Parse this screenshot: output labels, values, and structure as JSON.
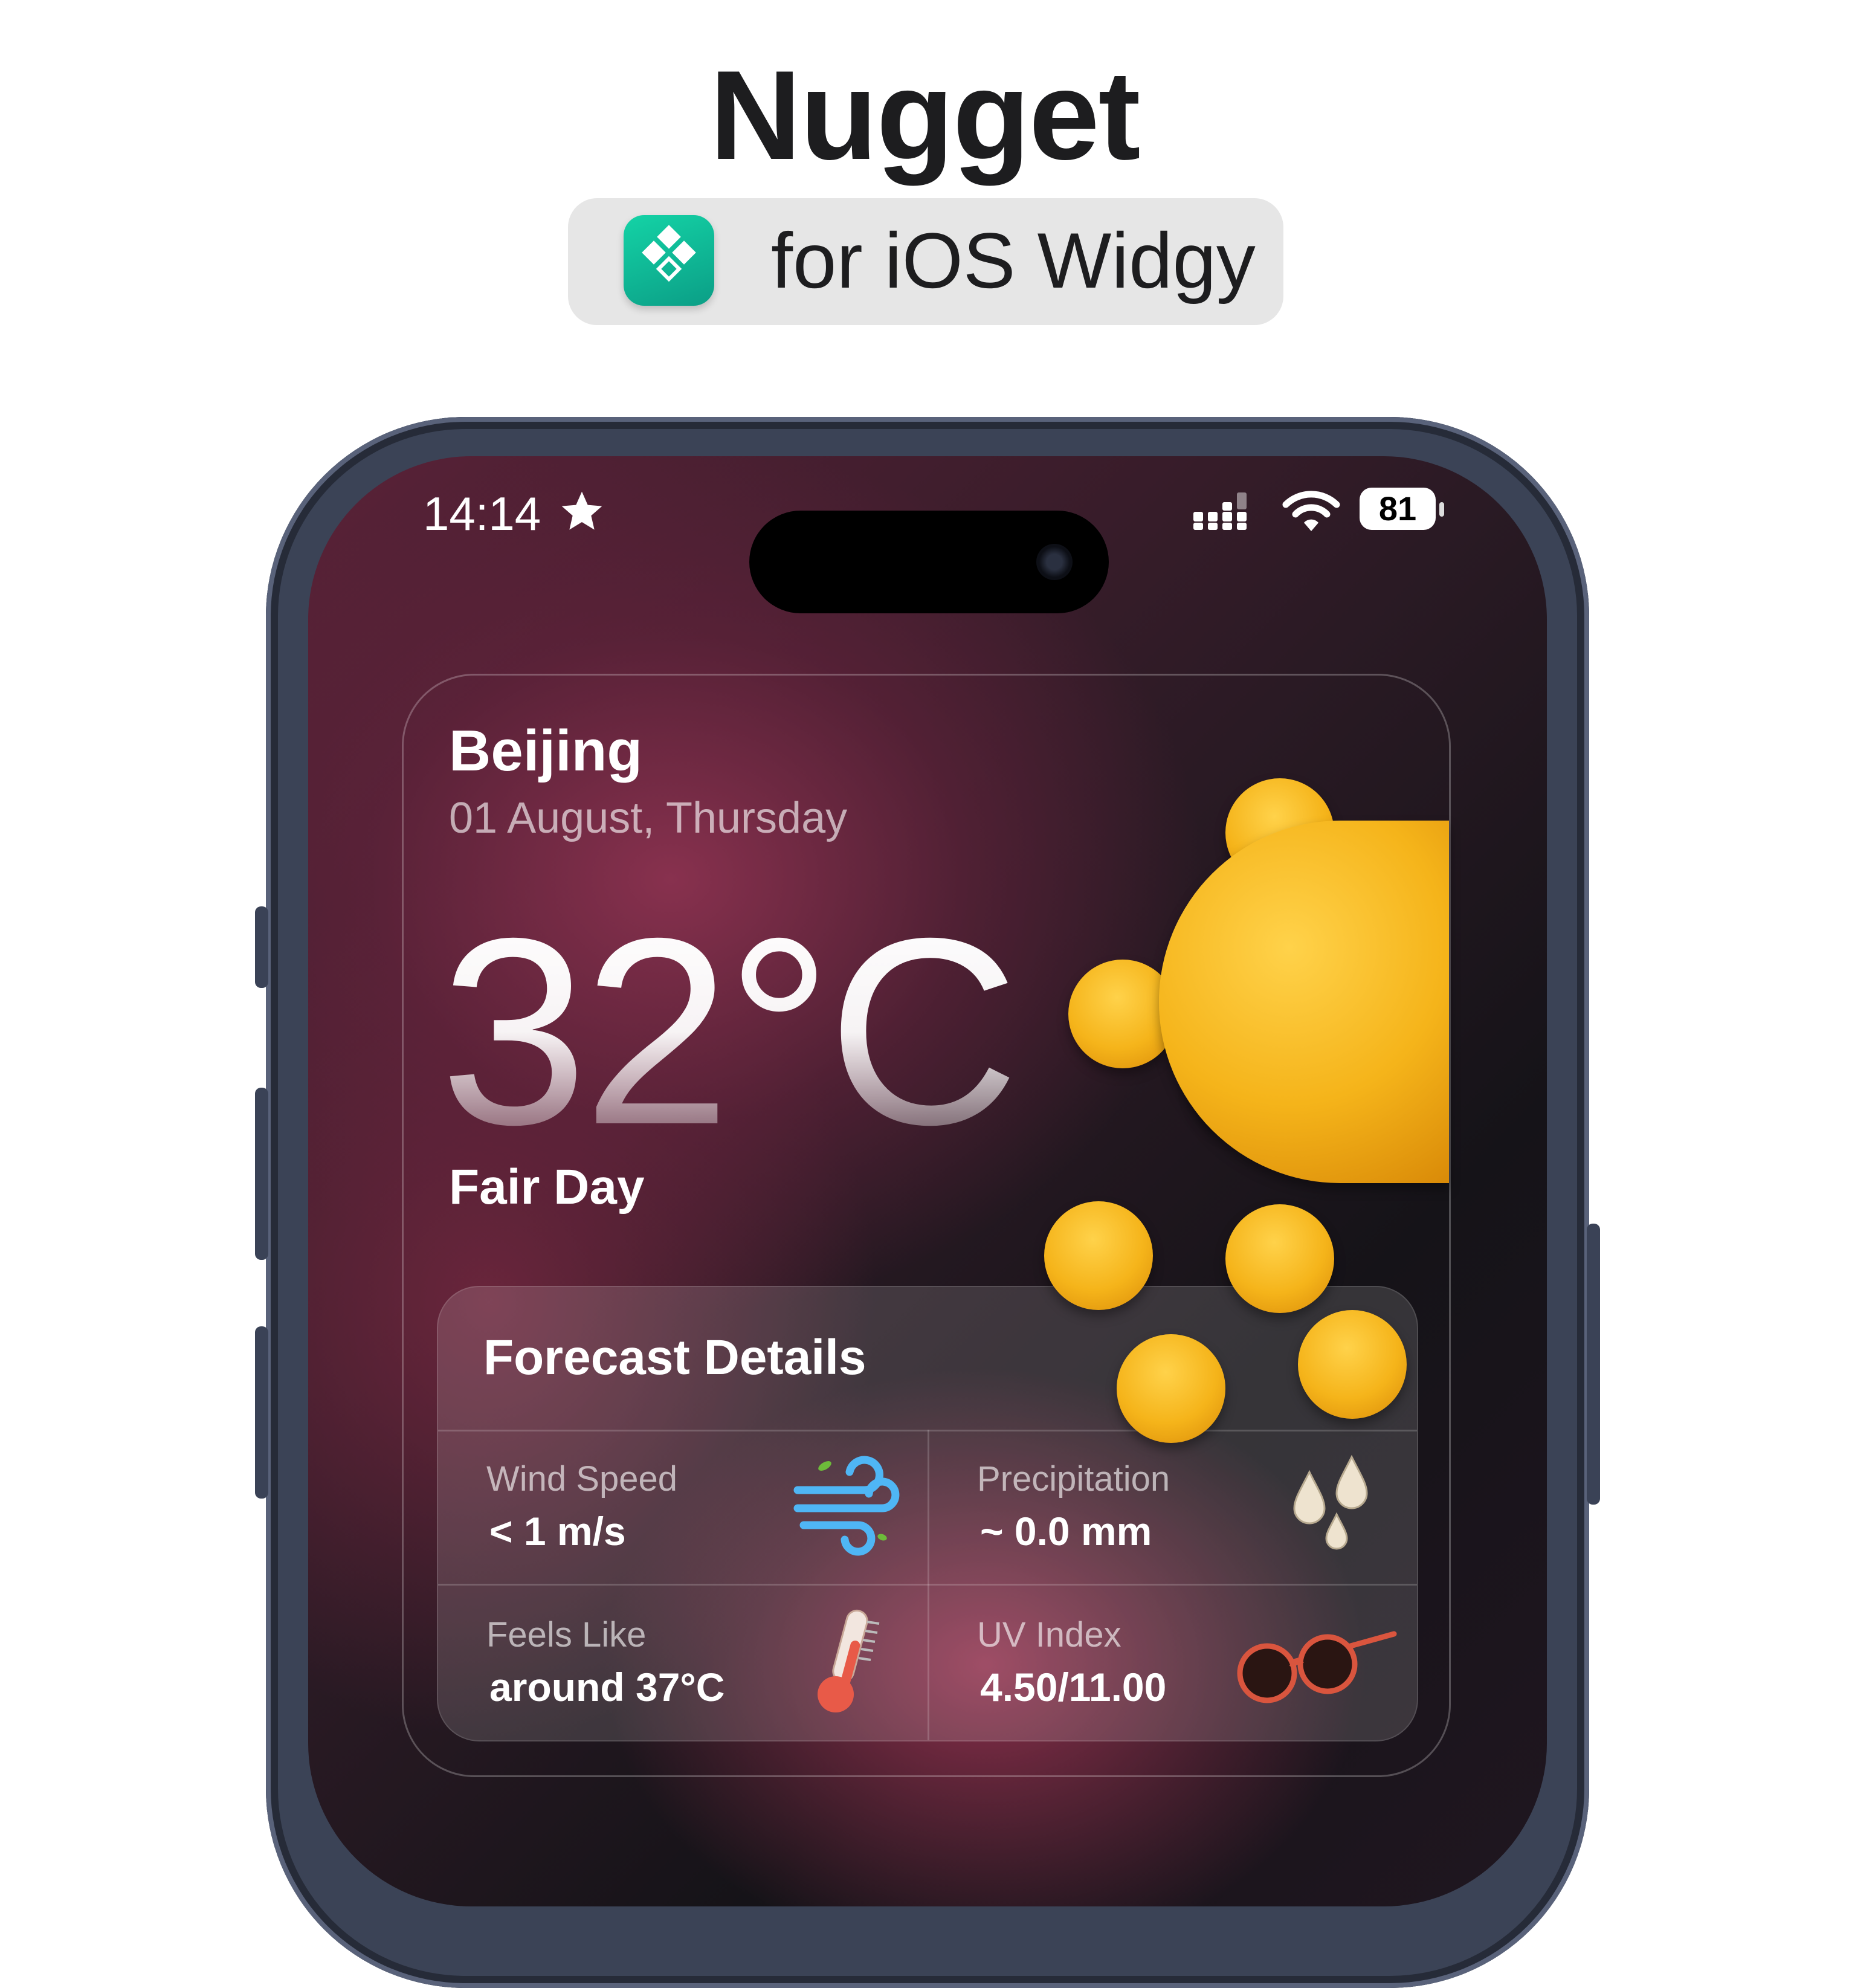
{
  "header": {
    "title": "Nugget",
    "subtitle": "for iOS Widgy",
    "app_icon": "widgy-app-icon"
  },
  "status_bar": {
    "time": "14:14",
    "time_icon": "star-icon",
    "battery": "81",
    "icons": [
      "signal-icon",
      "wifi-icon",
      "battery-icon"
    ]
  },
  "weather": {
    "city": "Beijing",
    "date": "01 August, Thursday",
    "temperature": "32°C",
    "condition": "Fair Day",
    "condition_icon": "sun-icon"
  },
  "forecast": {
    "title": "Forecast Details",
    "cells": [
      {
        "label": "Wind Speed",
        "value": "< 1 m/s",
        "icon": "wind-icon"
      },
      {
        "label": "Precipitation",
        "value": "~ 0.0 mm",
        "icon": "raindrops-icon"
      },
      {
        "label": "Feels Like",
        "value": "around 37°C",
        "icon": "thermometer-icon"
      },
      {
        "label": "UV Index",
        "value": "4.50/11.00",
        "icon": "sunglasses-icon"
      }
    ]
  },
  "colors": {
    "icon_teal": "#14d3a6",
    "sun_yellow": "#f5b41a",
    "frame": "#3b4356",
    "background_wine": "#5a2238"
  }
}
